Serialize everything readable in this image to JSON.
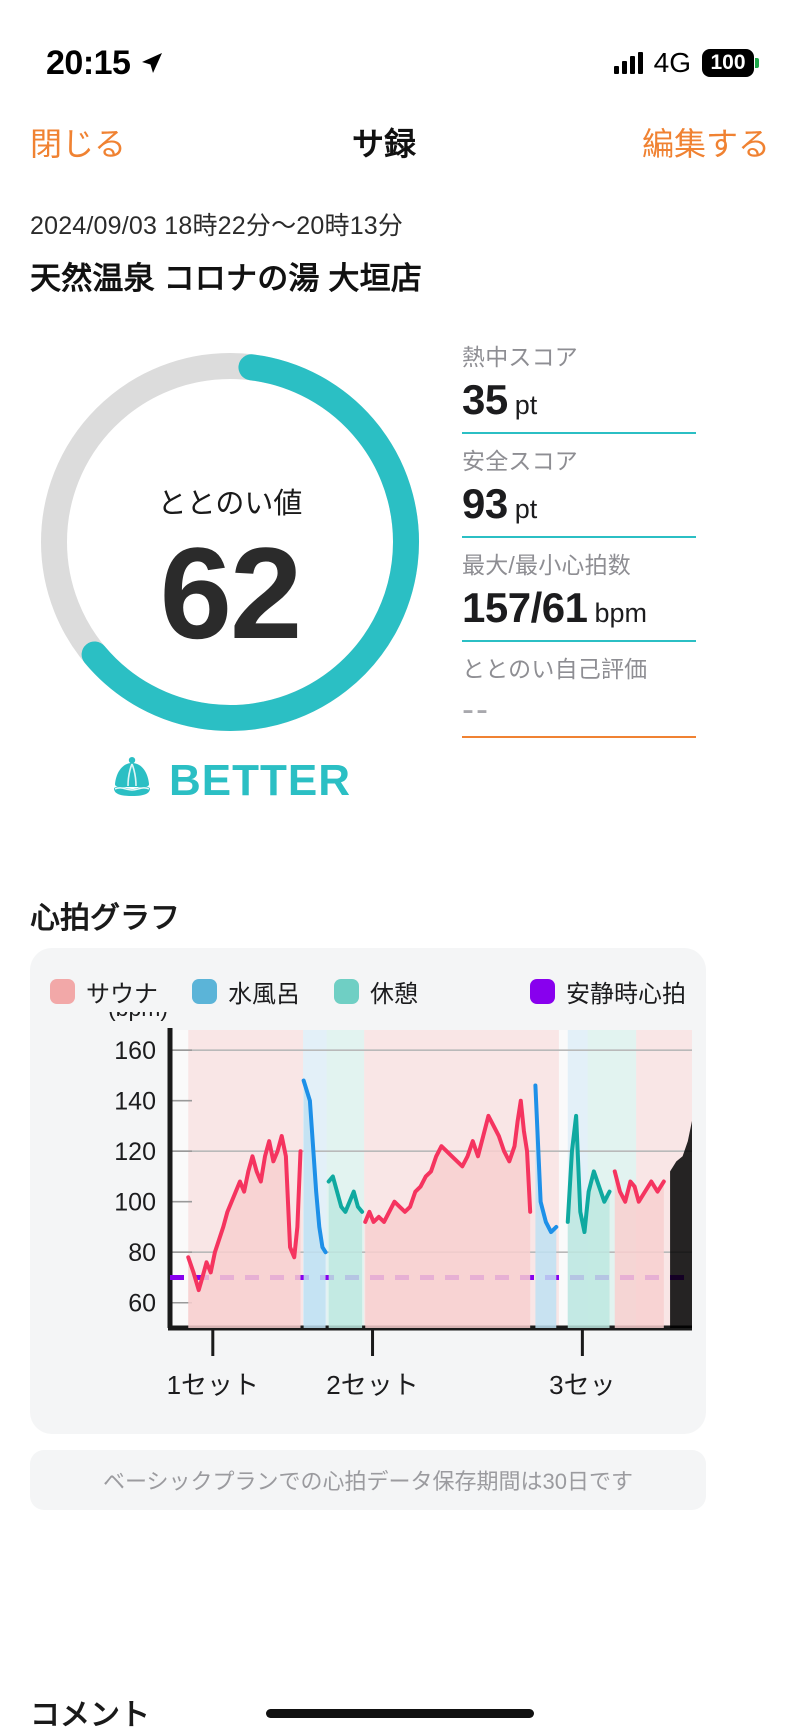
{
  "status_bar": {
    "time": "20:15",
    "location_icon": "location-arrow-icon",
    "signal_icon": "cellular-bars-icon",
    "network": "4G",
    "battery": "100"
  },
  "nav": {
    "close_label": "閉じる",
    "title": "サ録",
    "edit_label": "編集する"
  },
  "session": {
    "datetime": "2024/09/03 18時22分〜20時13分",
    "place": "天然温泉 コロナの湯 大垣店"
  },
  "gauge": {
    "label": "ととのい値",
    "value": "62",
    "percent": 62,
    "arc_color": "#2BBFC4",
    "track_color": "#DCDCDC",
    "verdict": "BETTER",
    "verdict_icon": "sauna-hat-icon"
  },
  "stats": [
    {
      "label": "熱中スコア",
      "value": "35",
      "unit": "pt",
      "rule": "#2BBFC4"
    },
    {
      "label": "安全スコア",
      "value": "93",
      "unit": "pt",
      "rule": "#2BBFC4"
    },
    {
      "label": "最大/最小心拍数",
      "value": "157/61",
      "unit": "bpm",
      "rule": "#2BBFC4"
    },
    {
      "label": "ととのい自己評価",
      "value": "--",
      "unit": "",
      "rule": "#F08232"
    }
  ],
  "heart_rate": {
    "title": "心拍グラフ",
    "notice": "ベーシックプランでの心拍データ保存期間は30日です"
  },
  "comment": {
    "title": "コメント"
  },
  "chart_data": {
    "type": "line",
    "title": "心拍グラフ",
    "ylabel": "(bpm)",
    "xlabel": "",
    "ylim": [
      50,
      168
    ],
    "yticks": [
      60,
      80,
      100,
      120,
      140,
      160
    ],
    "gridlines": [
      80,
      120,
      160
    ],
    "grid": true,
    "legend_position": "top",
    "legend": [
      {
        "name": "サウナ",
        "color": "#F2A8A8"
      },
      {
        "name": "水風呂",
        "color": "#5BB4D8"
      },
      {
        "name": "休憩",
        "color": "#6FCFC4"
      },
      {
        "name": "安静時心拍",
        "color": "#8800EE"
      }
    ],
    "xticks": [
      {
        "pos": 0.082,
        "label": "1セット"
      },
      {
        "pos": 0.388,
        "label": "2セット"
      },
      {
        "pos": 0.79,
        "label": "3セッ"
      }
    ],
    "resting_hr": 70,
    "resting_hr_color": "#8800EE",
    "line_colors": {
      "sauna": "#F5345F",
      "cold_bath": "#1E90E8",
      "rest": "#0FA9A0"
    },
    "zones": [
      {
        "type": "サウナ",
        "x0": 0.035,
        "x1": 0.255,
        "fill": "#F8D5D5"
      },
      {
        "type": "水風呂",
        "x0": 0.255,
        "x1": 0.3,
        "fill": "#CFE7F5"
      },
      {
        "type": "休憩",
        "x0": 0.3,
        "x1": 0.372,
        "fill": "#CDEDE7"
      },
      {
        "type": "サウナ",
        "x0": 0.372,
        "x1": 0.745,
        "fill": "#F8D5D5"
      },
      {
        "type": "水風呂",
        "x0": 0.762,
        "x1": 0.8,
        "fill": "#CFE7F5"
      },
      {
        "type": "休憩",
        "x0": 0.8,
        "x1": 0.893,
        "fill": "#CDEDE7"
      },
      {
        "type": "サウナ",
        "x0": 0.893,
        "x1": 1.0,
        "fill": "#F8D5D5"
      }
    ],
    "series": [
      {
        "name": "心拍数",
        "x": [
          0.035,
          0.045,
          0.055,
          0.062,
          0.07,
          0.078,
          0.086,
          0.094,
          0.102,
          0.11,
          0.118,
          0.126,
          0.134,
          0.142,
          0.15,
          0.158,
          0.166,
          0.174,
          0.182,
          0.19,
          0.198,
          0.206,
          0.214,
          0.222,
          0.23,
          0.238,
          0.244,
          0.25,
          0.256,
          0.262,
          0.268,
          0.274,
          0.28,
          0.286,
          0.292,
          0.298,
          0.304,
          0.312,
          0.32,
          0.328,
          0.336,
          0.344,
          0.352,
          0.36,
          0.368,
          0.374,
          0.382,
          0.39,
          0.4,
          0.41,
          0.42,
          0.43,
          0.44,
          0.45,
          0.46,
          0.47,
          0.48,
          0.49,
          0.5,
          0.51,
          0.52,
          0.53,
          0.54,
          0.55,
          0.56,
          0.57,
          0.58,
          0.59,
          0.6,
          0.61,
          0.62,
          0.63,
          0.64,
          0.65,
          0.66,
          0.666,
          0.672,
          0.678,
          0.684,
          0.69,
          0.7,
          0.71,
          0.72,
          0.73,
          0.74,
          0.762,
          0.77,
          0.778,
          0.786,
          0.794,
          0.802,
          0.812,
          0.822,
          0.832,
          0.842,
          0.852,
          0.862,
          0.872,
          0.882,
          0.89,
          0.898,
          0.91,
          0.922,
          0.934,
          0.946,
          0.958,
          0.97,
          0.982,
          0.992,
          1.0
        ],
        "y": [
          78,
          72,
          65,
          70,
          76,
          72,
          80,
          85,
          90,
          96,
          100,
          104,
          108,
          104,
          112,
          118,
          112,
          108,
          118,
          124,
          116,
          120,
          126,
          118,
          82,
          78,
          90,
          120,
          148,
          144,
          140,
          122,
          104,
          90,
          82,
          80,
          108,
          110,
          104,
          98,
          96,
          100,
          104,
          98,
          96,
          92,
          96,
          92,
          94,
          92,
          96,
          100,
          98,
          96,
          98,
          104,
          106,
          110,
          112,
          118,
          122,
          120,
          118,
          116,
          114,
          118,
          124,
          118,
          126,
          134,
          130,
          126,
          120,
          116,
          122,
          132,
          140,
          128,
          120,
          96,
          146,
          100,
          92,
          88,
          90,
          92,
          120,
          134,
          96,
          88,
          104,
          112,
          106,
          100,
          104,
          112,
          104,
          100,
          108,
          106,
          100,
          104,
          108,
          104,
          108,
          112,
          116,
          118,
          124,
          132
        ],
        "segment_types": [
          "sauna",
          "sauna",
          "sauna",
          "sauna",
          "sauna",
          "sauna",
          "sauna",
          "sauna",
          "sauna",
          "sauna",
          "sauna",
          "sauna",
          "sauna",
          "sauna",
          "sauna",
          "sauna",
          "sauna",
          "sauna",
          "sauna",
          "sauna",
          "sauna",
          "sauna",
          "sauna",
          "sauna",
          "sauna",
          "sauna",
          "sauna",
          "sauna",
          "cold",
          "cold",
          "cold",
          "cold",
          "cold",
          "cold",
          "cold",
          "cold",
          "rest",
          "rest",
          "rest",
          "rest",
          "rest",
          "rest",
          "rest",
          "rest",
          "rest",
          "sauna",
          "sauna",
          "sauna",
          "sauna",
          "sauna",
          "sauna",
          "sauna",
          "sauna",
          "sauna",
          "sauna",
          "sauna",
          "sauna",
          "sauna",
          "sauna",
          "sauna",
          "sauna",
          "sauna",
          "sauna",
          "sauna",
          "sauna",
          "sauna",
          "sauna",
          "sauna",
          "sauna",
          "sauna",
          "sauna",
          "sauna",
          "sauna",
          "sauna",
          "sauna",
          "sauna",
          "sauna",
          "sauna",
          "sauna",
          "sauna",
          "cold",
          "cold",
          "cold",
          "cold",
          "cold",
          "rest",
          "rest",
          "rest",
          "rest",
          "rest",
          "rest",
          "rest",
          "rest",
          "rest",
          "rest",
          "sauna",
          "sauna",
          "sauna",
          "sauna",
          "sauna",
          "sauna",
          "sauna",
          "sauna",
          "sauna",
          "sauna"
        ]
      }
    ]
  }
}
